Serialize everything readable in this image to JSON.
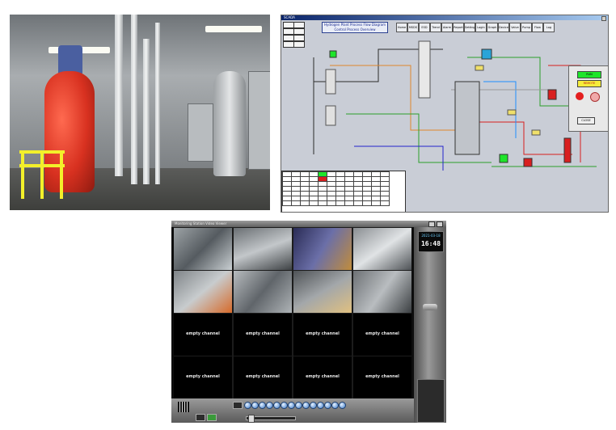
{
  "scada": {
    "title": "SCADA",
    "tabs": [
      "Home",
      "MSDS",
      "ESD",
      "Trend",
      "Alarm",
      "Report",
      "Setting",
      "Login",
      "Graph",
      "Device",
      "Valve",
      "Pump",
      "Flow",
      "Log"
    ],
    "banner_line1": "Hydrogen Plant Process Flow Diagram",
    "banner_line2": "Control Process Overview",
    "status_ok": "RUN",
    "status_warn": "REMOTE",
    "close_label": "CLOSE",
    "lamps": [
      "#e31e1e",
      "#f0a8a8"
    ]
  },
  "vms": {
    "title": "Monitoring Station Video Viewer",
    "date": "2021-03-18",
    "time": "16:48",
    "empty_label": "empty channel",
    "channel_count": 16,
    "live_channels": 8
  }
}
